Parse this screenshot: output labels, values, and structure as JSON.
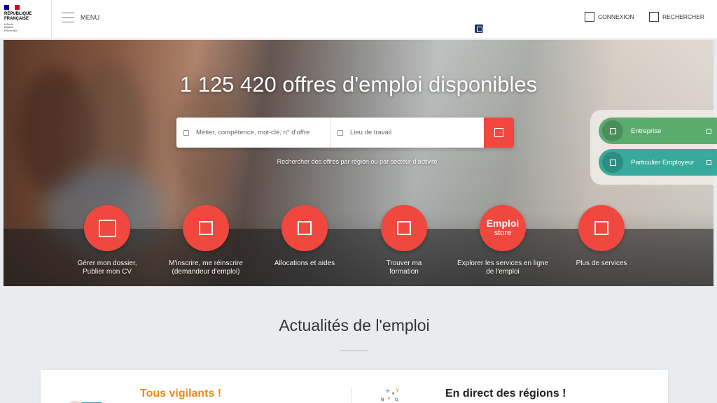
{
  "header": {
    "logo_lines": [
      "RÉPUBLIQUE",
      "FRANÇAISE"
    ],
    "logo_motto": [
      "Liberté",
      "Égalité",
      "Fraternité"
    ],
    "menu_label": "MENU",
    "connexion_label": "CONNEXION",
    "rechercher_label": "RECHERCHER"
  },
  "hero": {
    "title": "1 125 420 offres d'emploi disponibles",
    "search": {
      "keywords_placeholder": "Métier, compétence, mot-clé, n° d'offre",
      "location_placeholder": "Lieu de travail"
    },
    "browse_link": "Rechercher des offres par région ou par secteur d'activité"
  },
  "side_buttons": [
    {
      "label": "Entreprise",
      "color": "#5bab6d"
    },
    {
      "label": "Particulier Employeur",
      "color": "#38a99c"
    }
  ],
  "services": [
    {
      "label": "Gérer mon dossier, Publier mon CV",
      "icon": "square-icon"
    },
    {
      "label": "M'inscrire, me réinscrire (demandeur d'emploi)",
      "icon": "square-icon"
    },
    {
      "label": "Allocations et aides",
      "icon": "square-icon"
    },
    {
      "label": "Trouver ma formation",
      "icon": "square-icon"
    },
    {
      "label": "Explorer les services en ligne de l'emploi",
      "logo_top": "Emploi",
      "logo_bottom": "store"
    },
    {
      "label": "Plus de services",
      "icon": "square-icon"
    }
  ],
  "news": {
    "title": "Actualités de l'emploi",
    "cards": [
      {
        "title": "Tous vigilants !"
      },
      {
        "title": "En direct des régions !"
      }
    ]
  },
  "colors": {
    "accent": "#f0483e",
    "entreprise": "#5bab6d",
    "particulier": "#38a99c",
    "vigilants_title": "#f08a1c"
  }
}
